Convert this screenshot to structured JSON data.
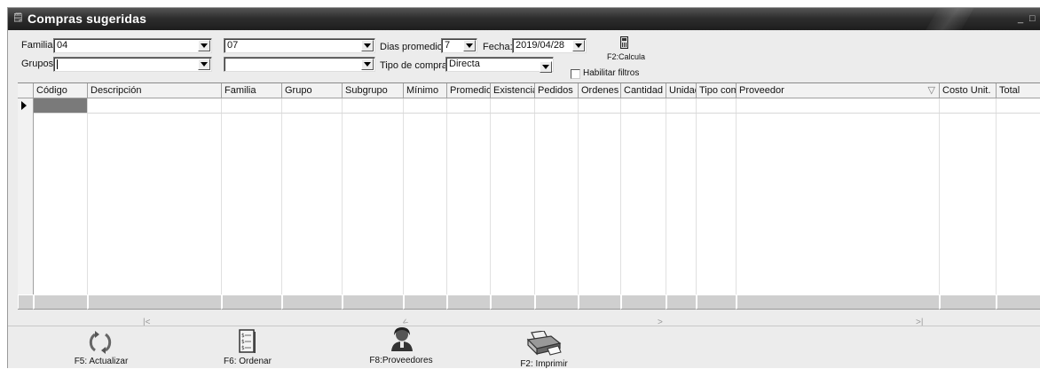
{
  "window": {
    "title": "Compras sugeridas",
    "app_icon": "🗒",
    "buttons": [
      "_",
      "□"
    ]
  },
  "filters": {
    "familias_label": "Familias:",
    "familias_from": "04",
    "familias_to": "07",
    "grupos_label": "Grupos:",
    "grupos_from": "",
    "grupos_to": "",
    "dias_label": "Dias promedio:",
    "dias_value": "7",
    "fecha_label": "Fecha:",
    "fecha_value": "2019/04/28",
    "tipo_label": "Tipo de compra:",
    "tipo_value": "Directa",
    "calc_label": "F2:Calcula",
    "habilitar_label": "Habilitar filtros"
  },
  "grid": {
    "columns": [
      "Código",
      "Descripción",
      "Familia",
      "Grupo",
      "Subgrupo",
      "Mínimo",
      "Promedio",
      "Existencia",
      "Pedidos",
      "Ordenes",
      "Cantidad",
      "Unidad",
      "Tipo com",
      "Proveedor",
      "Costo Unit.",
      "Total"
    ],
    "sort_icon": "▽"
  },
  "navigation": {
    "first": "|<",
    "prev": "<",
    "next": ">",
    "last": ">|"
  },
  "toolbar": {
    "actualizar": "F5: Actualizar",
    "ordenar": "F6: Ordenar",
    "proveedores": "F8:Proveedores",
    "imprimir": "F2: Imprimir"
  }
}
